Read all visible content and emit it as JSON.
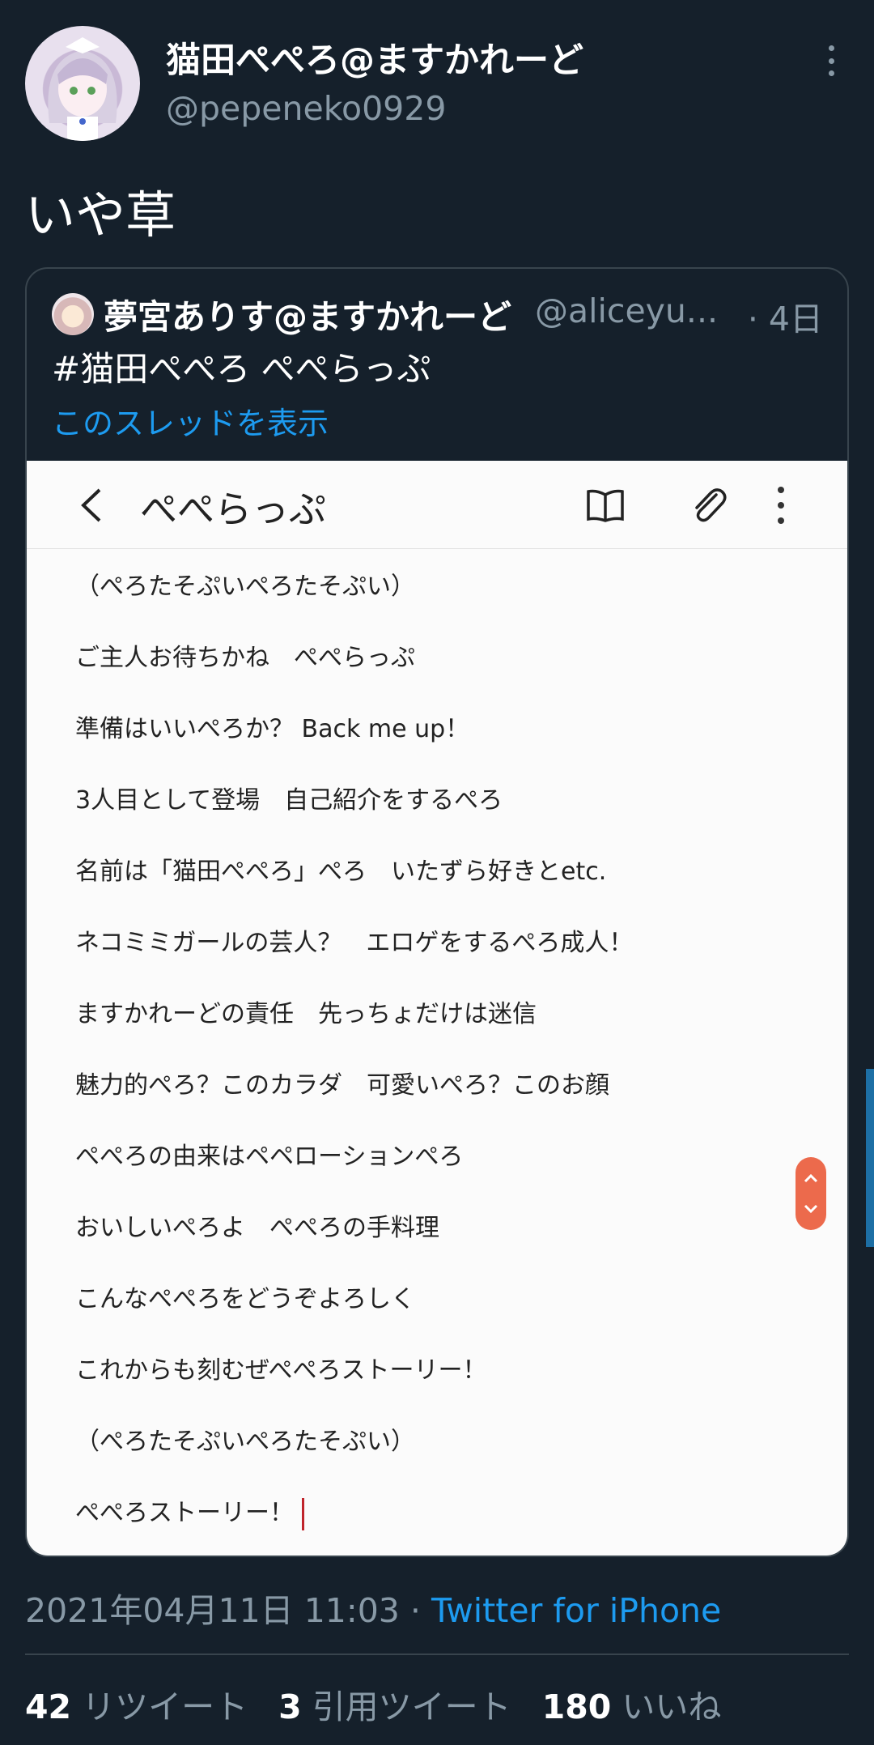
{
  "tweet": {
    "display_name": "猫田ぺぺろ@ますかれーど",
    "handle": "@pepeneko0929",
    "text": "いや草",
    "date": "2021年04月11日 11:03",
    "meta_sep": " · ",
    "source": "Twitter for iPhone",
    "avatar_icon": "user-avatar"
  },
  "quote": {
    "display_name": "夢宮ありす@ますかれーど",
    "handle": "@aliceyu...",
    "date": "· 4日",
    "text": "#猫田ぺぺろ ぺぺらっぷ",
    "thread_link": "このスレッドを表示"
  },
  "screenshot": {
    "title": "ぺぺらっぷ",
    "icons": [
      "back-icon",
      "book-icon",
      "paperclip-icon",
      "more-vert-icon"
    ],
    "lyrics": [
      "（ぺろたそぷいぺろたそぷい）",
      "ご主人お待ちかね　ぺぺらっぷ",
      "準備はいいぺろか？ Back me up！",
      "3人目として登場　自己紹介をするぺろ",
      "名前は「猫田ぺぺろ」ぺろ　いたずら好きとetc.",
      "ネコミミガールの芸人？　エロゲをするぺろ成人！",
      "ますかれーどの責任　先っちょだけは迷信",
      "魅力的ぺろ？このカラダ　可愛いぺろ？このお顔",
      "ぺぺろの由来はペペローションぺろ",
      "おいしいぺろよ　ぺぺろの手料理",
      "こんなぺぺろをどうぞよろしく",
      "これからも刻むぜぺぺろストーリー！",
      "（ぺろたそぷいぺろたそぷい）",
      "ぺぺろストーリー！"
    ],
    "accent_color": "#ec6a4c"
  },
  "stats": {
    "retweets_count": "42",
    "retweets_label": "リツイート",
    "quotes_count": "3",
    "quotes_label": "引用ツイート",
    "likes_count": "180",
    "likes_label": "いいね"
  },
  "colors": {
    "background": "#15202b",
    "secondary_text": "#8899a6",
    "link": "#1d9bf0",
    "border": "#38444d"
  }
}
